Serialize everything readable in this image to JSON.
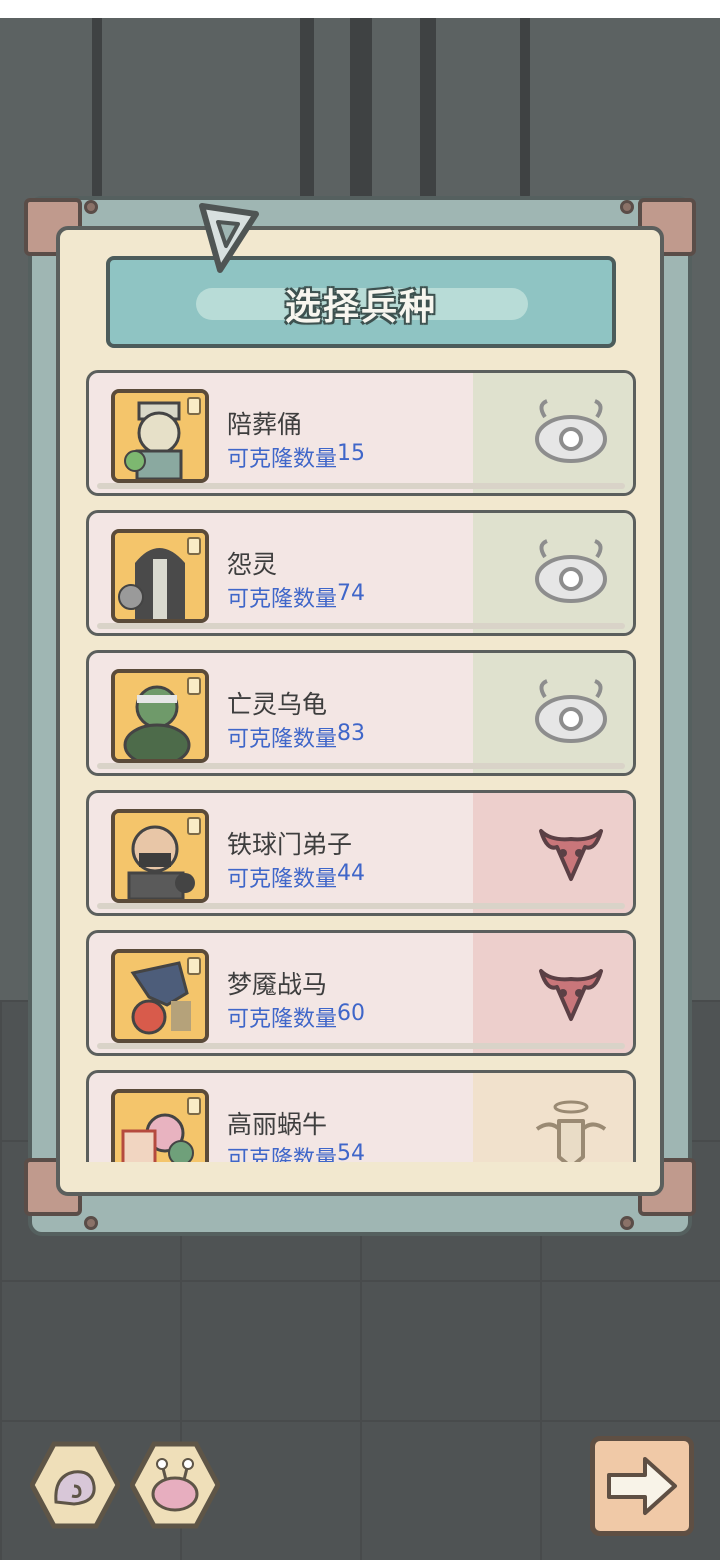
{
  "title": "选择兵种",
  "clone_label": "可克隆数量",
  "units": [
    {
      "name": "陪葬俑",
      "count": "15",
      "faction": "undead",
      "portrait": "terracotta-warrior"
    },
    {
      "name": "怨灵",
      "count": "74",
      "faction": "undead",
      "portrait": "ghost"
    },
    {
      "name": "亡灵乌龟",
      "count": "83",
      "faction": "undead",
      "portrait": "undead-turtle"
    },
    {
      "name": "铁球门弟子",
      "count": "44",
      "faction": "demon",
      "portrait": "iron-ball-disciple"
    },
    {
      "name": "梦魇战马",
      "count": "60",
      "faction": "demon",
      "portrait": "nightmare-warhorse"
    },
    {
      "name": "高丽蜗牛",
      "count": "54",
      "faction": "holy",
      "portrait": "goryeo-snail"
    }
  ],
  "faction_colors": {
    "undead": "#b9d7a6",
    "demon": "#e2a2a0",
    "holy": "#efd6a0"
  },
  "bottom_icons": [
    "snail-shell-icon",
    "snail-face-icon",
    "arrow-right-icon"
  ]
}
